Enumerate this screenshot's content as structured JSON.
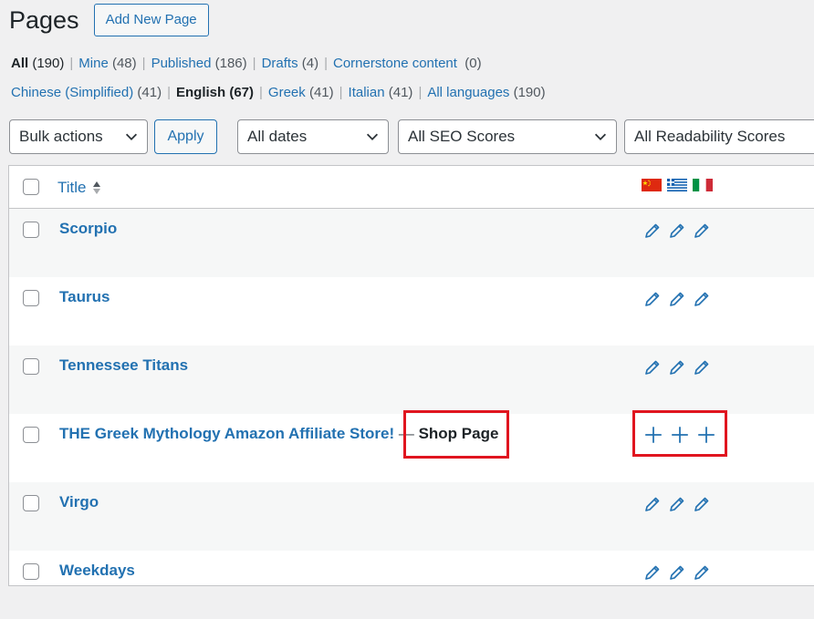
{
  "header": {
    "title": "Pages",
    "add_new": "Add New Page"
  },
  "status_filters": [
    {
      "label": "All",
      "count": "(190)",
      "current": true
    },
    {
      "label": "Mine",
      "count": "(48)"
    },
    {
      "label": "Published",
      "count": "(186)"
    },
    {
      "label": "Drafts",
      "count": "(4)"
    },
    {
      "label": "Cornerstone content",
      "count": "(0)"
    }
  ],
  "language_filters": [
    {
      "label": "Chinese (Simplified)",
      "count": "(41)"
    },
    {
      "label": "English",
      "count": "(67)",
      "current": true
    },
    {
      "label": "Greek",
      "count": "(41)"
    },
    {
      "label": "Italian",
      "count": "(41)"
    },
    {
      "label": "All languages",
      "count": "(190)"
    }
  ],
  "toolbar": {
    "bulk_actions": "Bulk actions",
    "apply": "Apply",
    "dates": "All dates",
    "seo": "All SEO Scores",
    "readability": "All Readability Scores"
  },
  "table": {
    "col_title": "Title",
    "flags": [
      "Chinese (Simplified)",
      "Greek",
      "Italian"
    ],
    "rows": [
      {
        "title": "Scorpio",
        "actions": "edit"
      },
      {
        "title": "Taurus",
        "actions": "edit"
      },
      {
        "title": "Tennessee Titans",
        "actions": "edit"
      },
      {
        "title": "THE Greek Mythology Amazon Affiliate Store!",
        "dash": " — ",
        "state": "Shop Page",
        "actions": "add"
      },
      {
        "title": "Virgo",
        "actions": "edit"
      },
      {
        "title": "Weekdays",
        "actions": "edit"
      }
    ]
  },
  "colors": {
    "link": "#2271b1",
    "highlight": "#e0151f",
    "text": "#1d2327"
  },
  "icons": {
    "edit": "pencil-icon",
    "add": "plus-icon",
    "dropdown": "chevron-down-icon",
    "sort": "sort-arrows-icon"
  }
}
